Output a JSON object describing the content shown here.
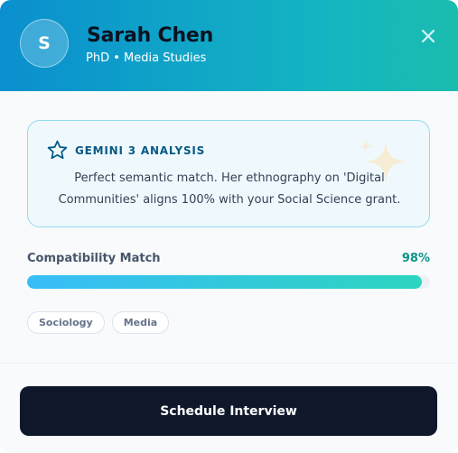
{
  "profile": {
    "avatar_initial": "S",
    "name": "Sarah Chen",
    "subtitle": "PhD • Media Studies"
  },
  "header": {
    "close_icon": "close-icon"
  },
  "analysis": {
    "icon": "star-icon",
    "title": "GEMINI 3 ANALYSIS",
    "text": "Perfect semantic match. Her ethnography on 'Digital Communities' aligns 100% with your Social Science grant."
  },
  "compatibility": {
    "label": "Compatibility Match",
    "value_text": "98%",
    "value": 98
  },
  "tags": [
    "Sociology",
    "Media"
  ],
  "actions": {
    "schedule_label": "Schedule Interview"
  },
  "colors": {
    "header_gradient_start": "#0a8fcf",
    "header_gradient_end": "#1bbcae",
    "accent_teal": "#0d9488",
    "button_dark": "#0f172a"
  }
}
